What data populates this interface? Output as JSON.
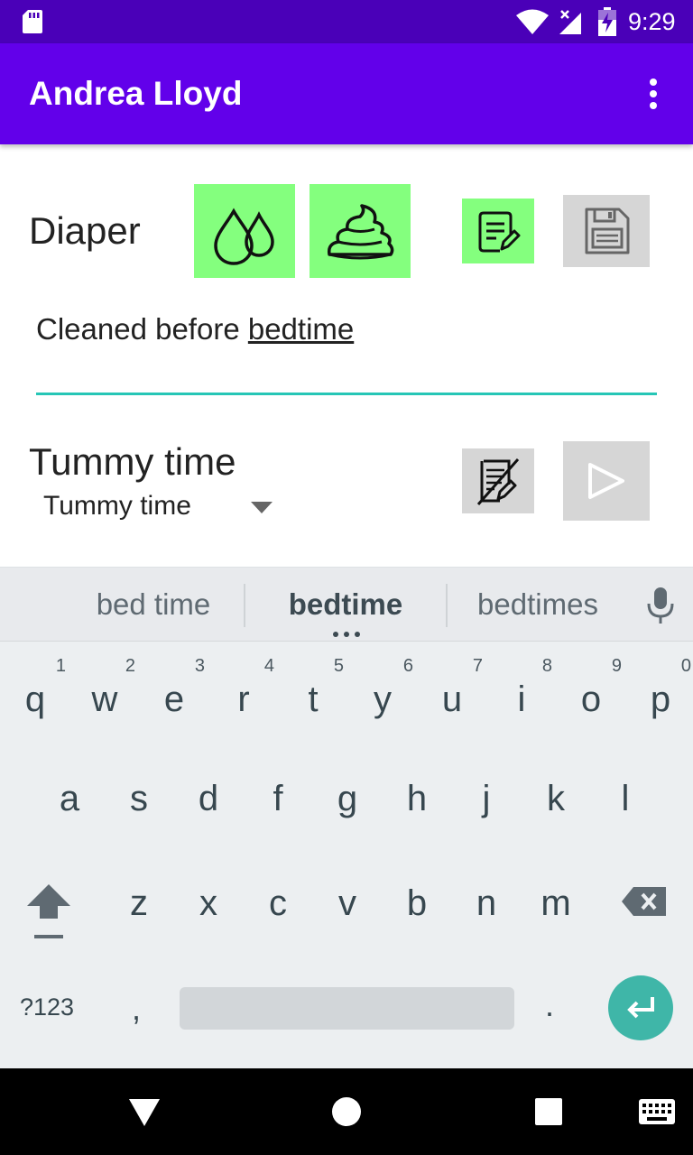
{
  "status_bar": {
    "time": "9:29"
  },
  "app_bar": {
    "title": "Andrea Lloyd"
  },
  "diaper": {
    "label": "Diaper",
    "note_prefix": "Cleaned before ",
    "note_word": "bedtime"
  },
  "tummy": {
    "label": "Tummy time",
    "spinner_value": "Tummy time"
  },
  "colors": {
    "appbar": "#6200ea",
    "status": "#4a00b8",
    "active_btn": "#84ff7e",
    "inactive_btn": "#d6d6d6",
    "accent": "#26c6b6"
  },
  "keyboard": {
    "suggestions": [
      "bed time",
      "bedtime",
      "bedtimes"
    ],
    "row1": [
      {
        "k": "q",
        "h": "1"
      },
      {
        "k": "w",
        "h": "2"
      },
      {
        "k": "e",
        "h": "3"
      },
      {
        "k": "r",
        "h": "4"
      },
      {
        "k": "t",
        "h": "5"
      },
      {
        "k": "y",
        "h": "6"
      },
      {
        "k": "u",
        "h": "7"
      },
      {
        "k": "i",
        "h": "8"
      },
      {
        "k": "o",
        "h": "9"
      },
      {
        "k": "p",
        "h": "0"
      }
    ],
    "row2": [
      "a",
      "s",
      "d",
      "f",
      "g",
      "h",
      "j",
      "k",
      "l"
    ],
    "row3": [
      "z",
      "x",
      "c",
      "v",
      "b",
      "n",
      "m"
    ],
    "symbols_label": "?123",
    "comma": ",",
    "period": "."
  }
}
